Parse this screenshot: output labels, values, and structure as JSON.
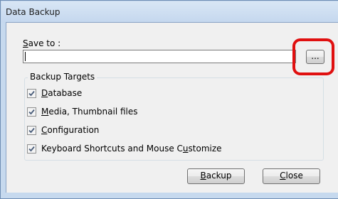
{
  "window": {
    "title": "Data Backup"
  },
  "save_to": {
    "label_access_key": "S",
    "label_rest": "ave to :",
    "path_value": "",
    "browse_label": "..."
  },
  "backup_targets": {
    "title": "Backup Targets",
    "items": [
      {
        "pre": "",
        "key": "D",
        "post": "atabase",
        "checked": true
      },
      {
        "pre": "",
        "key": "M",
        "post": "edia, Thumbnail files",
        "checked": true
      },
      {
        "pre": "",
        "key": "C",
        "post": "onfiguration",
        "checked": true
      },
      {
        "pre": "Keyboard Shortcuts and Mouse C",
        "key": "u",
        "post": "stomize",
        "checked": true
      }
    ]
  },
  "buttons": {
    "backup": {
      "key": "B",
      "rest": "ackup"
    },
    "close": {
      "key": "C",
      "rest": "lose"
    }
  },
  "colors": {
    "highlight": "#e01010",
    "window_frame": "#c6d9ee",
    "dialog_background": "#f0f0f0"
  }
}
